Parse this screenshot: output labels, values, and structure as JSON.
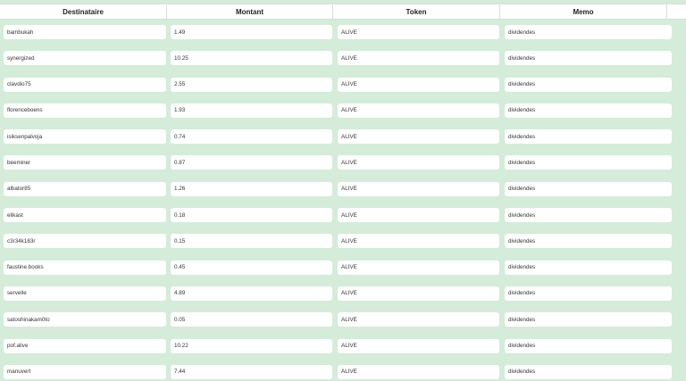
{
  "table": {
    "columns": [
      "Destinataire",
      "Montant",
      "Token",
      "Memo"
    ],
    "rows": [
      {
        "recipient": "bambukah",
        "amount": "1.49",
        "token": "ALIVE",
        "memo": "dividendes"
      },
      {
        "recipient": "synergized",
        "amount": "10.25",
        "token": "ALIVE",
        "memo": "dividendes"
      },
      {
        "recipient": "clavdio75",
        "amount": "2.55",
        "token": "ALIVE",
        "memo": "dividendes"
      },
      {
        "recipient": "florenceboens",
        "amount": "1.93",
        "token": "ALIVE",
        "memo": "dividendes"
      },
      {
        "recipient": "isiksenpalvoja",
        "amount": "0.74",
        "token": "ALIVE",
        "memo": "dividendes"
      },
      {
        "recipient": "beeminer",
        "amount": "0.87",
        "token": "ALIVE",
        "memo": "dividendes"
      },
      {
        "recipient": "albator85",
        "amount": "1.26",
        "token": "ALIVE",
        "memo": "dividendes"
      },
      {
        "recipient": "elikast",
        "amount": "0.18",
        "token": "ALIVE",
        "memo": "dividendes"
      },
      {
        "recipient": "c3r34k183r",
        "amount": "0.15",
        "token": "ALIVE",
        "memo": "dividendes"
      },
      {
        "recipient": "faustine.books",
        "amount": "0.45",
        "token": "ALIVE",
        "memo": "dividendes"
      },
      {
        "recipient": "servelle",
        "amount": "4.89",
        "token": "ALIVE",
        "memo": "dividendes"
      },
      {
        "recipient": "satoshinakam0to",
        "amount": "0.05",
        "token": "ALIVE",
        "memo": "dividendes"
      },
      {
        "recipient": "pof.alive",
        "amount": "10.22",
        "token": "ALIVE",
        "memo": "dividendes"
      },
      {
        "recipient": "manuvert",
        "amount": "7.44",
        "token": "ALIVE",
        "memo": "dividendes"
      }
    ]
  },
  "colors": {
    "background": "#d4ecd9",
    "field": "#ffffff",
    "header": "#ffffff"
  }
}
